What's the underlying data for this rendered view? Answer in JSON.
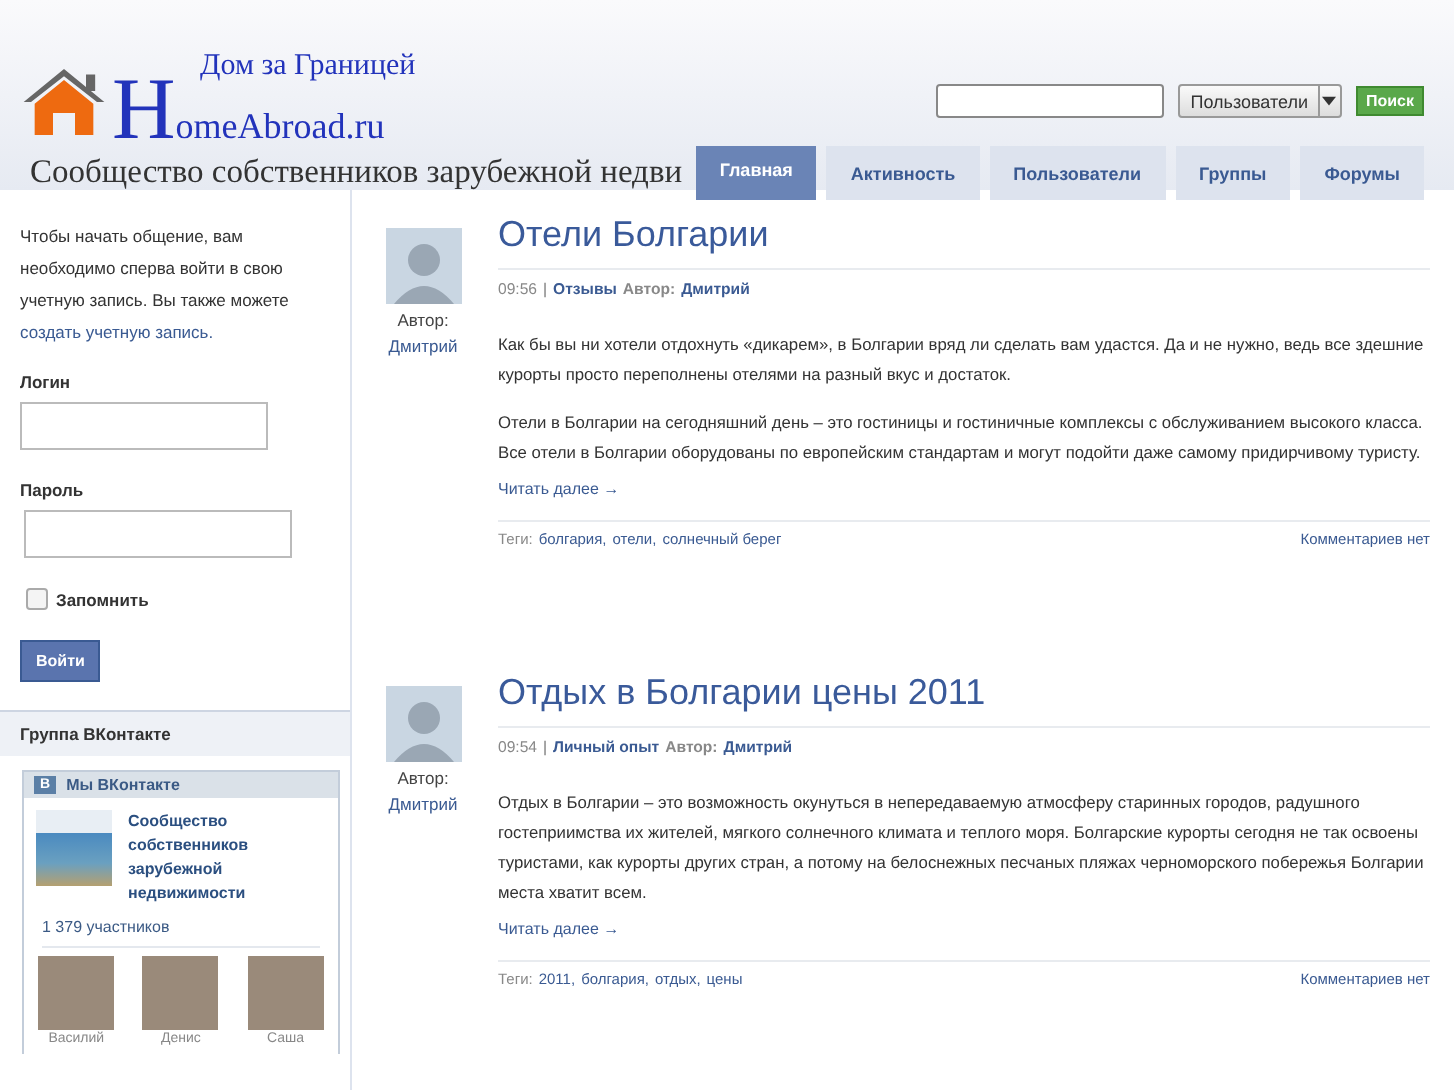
{
  "header": {
    "subtitle": "Дом за Границей",
    "wordmark": "HomeAbroad.ru",
    "tagline": "Сообщество собственников зарубежной недви",
    "scope": "Пользователи",
    "search_button": "Поиск"
  },
  "nav": [
    {
      "label": "Главная",
      "selected": true
    },
    {
      "label": "Активность",
      "selected": false
    },
    {
      "label": "Пользователи",
      "selected": false
    },
    {
      "label": "Группы",
      "selected": false
    },
    {
      "label": "Форумы",
      "selected": false
    }
  ],
  "sidebar": {
    "intro": "Чтобы начать общение, вам необходимо сперва войти в свою учетную запись. Вы также можете",
    "signup_link": "создать учетную запись.",
    "login_label": "Логин",
    "password_label": "Пароль",
    "remember": {
      "label": "Запомнить",
      "checked": false
    },
    "login_button": "Войти",
    "vk_title": "Группа ВКонтакте",
    "vk_widget": {
      "icon": "В",
      "title": "Мы ВКонтакте",
      "group": "Сообщество собственников зарубежной недвижимости",
      "members_count": "1 379 участников",
      "members": [
        "Василий",
        "Денис",
        "Саша"
      ]
    }
  },
  "posts": [
    {
      "author_label": "Автор:",
      "author": "Дмитрий",
      "title": "Отели Болгарии",
      "time": "09:56",
      "separator": "|",
      "category": "Отзывы",
      "meta_author_label": "Автор:",
      "meta_author": "Дмитрий",
      "paragraphs": [
        "Как бы вы ни хотели отдохнуть «дикарем», в Болгарии вряд ли сделать вам удастся. Да и не нужно, ведь все здешние курорты просто переполнены отелями на разный вкус и достаток.",
        "Отели в Болгарии на сегодняшний день – это гостиницы и гостиничные комплексы с обслуживанием высокого класса. Все отели в Болгарии оборудованы по европейским стандартам и могут подойти даже самому придирчивому туристу."
      ],
      "read_more": "Читать далее →",
      "tags_label": "Теги:",
      "tags": [
        "болгария,",
        "отели,",
        "солнечный берег"
      ],
      "comments": "Комментариев нет"
    },
    {
      "author_label": "Автор:",
      "author": "Дмитрий",
      "title": "Отдых в Болгарии цены 2011",
      "time": "09:54",
      "separator": "|",
      "category": "Личный опыт",
      "meta_author_label": "Автор:",
      "meta_author": "Дмитрий",
      "paragraphs": [
        "Отдых в Болгарии – это возможность окунуться в непередаваемую атмосферу старинных городов, радушного гостеприимства их жителей, мягкого солнечного климата и теплого моря. Болгарские курорты сегодня не так освоены туристами, как курорты других стран, а потому на белоснежных песчаных пляжах черноморского побережья Болгарии места хватит всем."
      ],
      "read_more": "Читать далее →",
      "tags_label": "Теги:",
      "tags": [
        "2011,",
        "болгария,",
        "отдых,",
        "цены"
      ],
      "comments": "Комментариев нет"
    }
  ]
}
